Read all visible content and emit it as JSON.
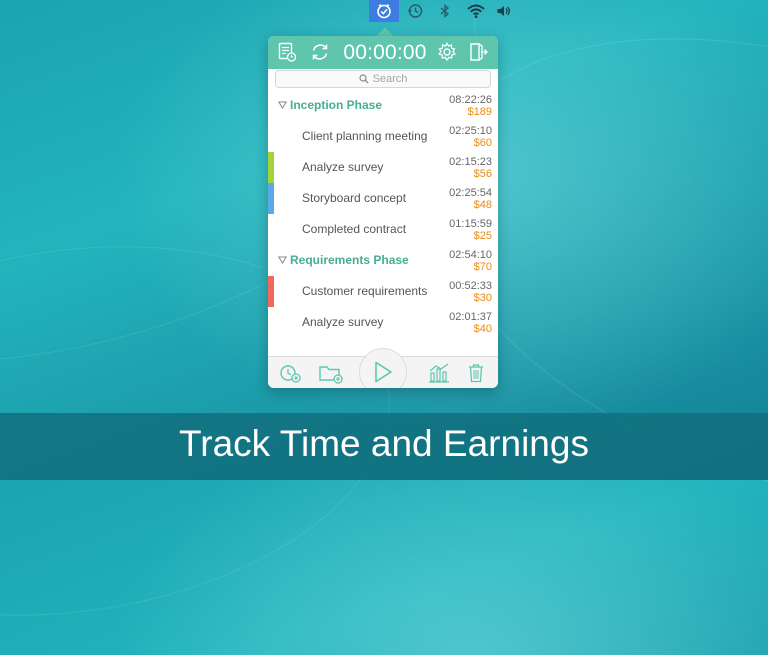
{
  "menubar": {
    "icons": [
      "app-clock-icon",
      "time-machine-icon",
      "bluetooth-icon",
      "wifi-icon",
      "volume-icon"
    ]
  },
  "popover": {
    "timer": "00:00:00",
    "toolbar_icons": [
      "report-icon",
      "sync-icon",
      "settings-icon",
      "exit-icon"
    ],
    "search_placeholder": "Search",
    "groups": [
      {
        "name": "Inception Phase",
        "time": "08:22:26",
        "earnings": "$189",
        "tasks": [
          {
            "name": "Client planning meeting",
            "time": "02:25:10",
            "earnings": "$60",
            "color": ""
          },
          {
            "name": "Analyze survey",
            "time": "02:15:23",
            "earnings": "$56",
            "color": "#a3d33a"
          },
          {
            "name": "Storyboard concept",
            "time": "02:25:54",
            "earnings": "$48",
            "color": "#5aa9e8"
          },
          {
            "name": "Completed contract",
            "time": "01:15:59",
            "earnings": "$25",
            "color": ""
          }
        ]
      },
      {
        "name": "Requirements Phase",
        "time": "02:54:10",
        "earnings": "$70",
        "tasks": [
          {
            "name": "Customer requirements",
            "time": "00:52:33",
            "earnings": "$30",
            "color": "#f0695a"
          },
          {
            "name": "Analyze survey",
            "time": "02:01:37",
            "earnings": "$40",
            "color": ""
          }
        ]
      }
    ],
    "bottom_icons": [
      "add-timer-icon",
      "add-folder-icon",
      "play-icon",
      "chart-icon",
      "trash-icon"
    ]
  },
  "colors": {
    "accent": "#5fc6ad",
    "group_text": "#47ad93",
    "earnings": "#ee8c0f",
    "menubar_active": "#3e7de0"
  },
  "caption": "Track Time and Earnings"
}
